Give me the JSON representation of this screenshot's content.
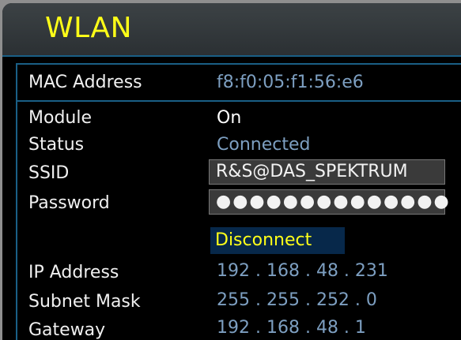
{
  "window": {
    "title": "WLAN"
  },
  "rows": {
    "mac": {
      "label": "MAC Address",
      "value": "f8:f0:05:f1:56:e6"
    },
    "module": {
      "label": "Module",
      "value": "On"
    },
    "status": {
      "label": "Status",
      "value": "Connected"
    },
    "ssid": {
      "label": "SSID",
      "value": "R&S@DAS_SPEKTRUM"
    },
    "password": {
      "label": "Password",
      "value": "●●●●●●●●●●●●●●"
    },
    "ip": {
      "label": "IP Address",
      "value": "192 . 168 .   48 . 231"
    },
    "subnet": {
      "label": "Subnet Mask",
      "value": "255 . 255 . 252 .     0"
    },
    "gateway": {
      "label": "Gateway",
      "value": "192 . 168 .   48 .     1"
    }
  },
  "actions": {
    "disconnect": "Disconnect"
  },
  "colors": {
    "title": "#ffff18",
    "accent": "#1a5f86",
    "value": "#7d9fc1",
    "button_bg": "#07284a"
  }
}
